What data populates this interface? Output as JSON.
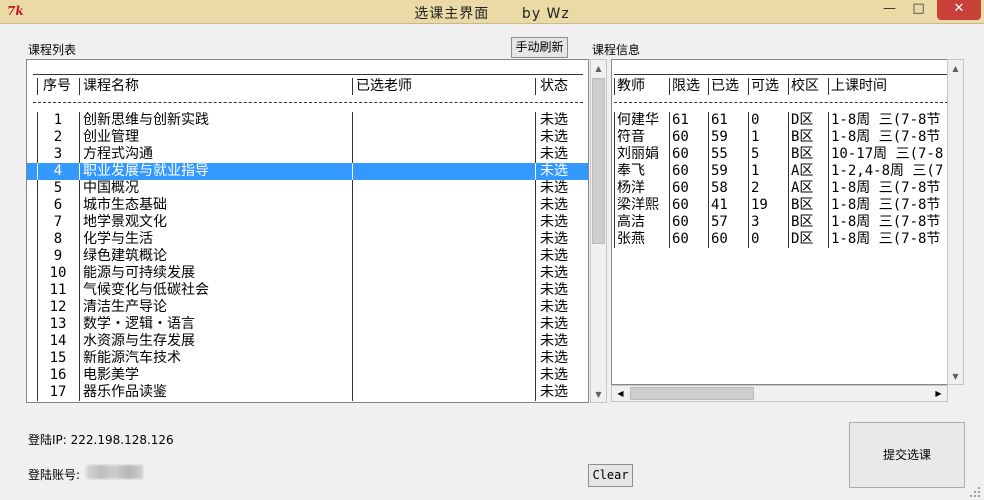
{
  "window": {
    "title": "选课主界面      by Wz",
    "icon_text": "7k",
    "controls": {
      "minimize": "—",
      "maximize": "□",
      "close": "✕"
    }
  },
  "left": {
    "label": "课程列表",
    "refresh_button": "手动刷新",
    "headers": {
      "seq": "序号",
      "name": "课程名称",
      "teacher": "已选老师",
      "status": "状态"
    },
    "rows": [
      {
        "seq": "1",
        "name": "创新思维与创新实践",
        "teacher": "",
        "status": "未选"
      },
      {
        "seq": "2",
        "name": "创业管理",
        "teacher": "",
        "status": "未选"
      },
      {
        "seq": "3",
        "name": "方程式沟通",
        "teacher": "",
        "status": "未选"
      },
      {
        "seq": "4",
        "name": "职业发展与就业指导",
        "teacher": "",
        "status": "未选"
      },
      {
        "seq": "5",
        "name": "中国概况",
        "teacher": "",
        "status": "未选"
      },
      {
        "seq": "6",
        "name": "城市生态基础",
        "teacher": "",
        "status": "未选"
      },
      {
        "seq": "7",
        "name": "地学景观文化",
        "teacher": "",
        "status": "未选"
      },
      {
        "seq": "8",
        "name": "化学与生活",
        "teacher": "",
        "status": "未选"
      },
      {
        "seq": "9",
        "name": "绿色建筑概论",
        "teacher": "",
        "status": "未选"
      },
      {
        "seq": "10",
        "name": "能源与可持续发展",
        "teacher": "",
        "status": "未选"
      },
      {
        "seq": "11",
        "name": "气候变化与低碳社会",
        "teacher": "",
        "status": "未选"
      },
      {
        "seq": "12",
        "name": "清洁生产导论",
        "teacher": "",
        "status": "未选"
      },
      {
        "seq": "13",
        "name": "数学・逻辑・语言",
        "teacher": "",
        "status": "未选"
      },
      {
        "seq": "14",
        "name": "水资源与生存发展",
        "teacher": "",
        "status": "未选"
      },
      {
        "seq": "15",
        "name": "新能源汽车技术",
        "teacher": "",
        "status": "未选"
      },
      {
        "seq": "16",
        "name": "电影美学",
        "teacher": "",
        "status": "未选"
      },
      {
        "seq": "17",
        "name": "器乐作品读鉴",
        "teacher": "",
        "status": "未选"
      }
    ],
    "selected_row": 4
  },
  "right": {
    "label": "课程信息",
    "headers": {
      "teacher": "教师",
      "limit": "限选",
      "chosen": "已选",
      "available": "可选",
      "campus": "校区",
      "time": "上课时间"
    },
    "rows": [
      {
        "teacher": "何建华",
        "limit": "61",
        "chosen": "61",
        "available": "0",
        "campus": "D区",
        "time": "1-8周 三(7-8节"
      },
      {
        "teacher": "符音",
        "limit": "60",
        "chosen": "59",
        "available": "1",
        "campus": "B区",
        "time": "1-8周 三(7-8节"
      },
      {
        "teacher": "刘丽娟",
        "limit": "60",
        "chosen": "55",
        "available": "5",
        "campus": "B区",
        "time": "10-17周 三(7-8"
      },
      {
        "teacher": "奉飞",
        "limit": "60",
        "chosen": "59",
        "available": "1",
        "campus": "A区",
        "time": "1-2,4-8周 三(7"
      },
      {
        "teacher": "杨洋",
        "limit": "60",
        "chosen": "58",
        "available": "2",
        "campus": "A区",
        "time": "1-8周 三(7-8节"
      },
      {
        "teacher": "梁洋熙",
        "limit": "60",
        "chosen": "41",
        "available": "19",
        "campus": "B区",
        "time": "1-8周 三(7-8节"
      },
      {
        "teacher": "高洁",
        "limit": "60",
        "chosen": "57",
        "available": "3",
        "campus": "B区",
        "time": "1-8周 三(7-8节"
      },
      {
        "teacher": "张燕",
        "limit": "60",
        "chosen": "60",
        "available": "0",
        "campus": "D区",
        "time": "1-8周 三(7-8节"
      }
    ]
  },
  "footer": {
    "ip_label": "登陆IP: 222.198.128.126",
    "account_label": "登陆账号:",
    "clear_button": "Clear",
    "submit_button": "提交选课"
  },
  "colors": {
    "titlebar": "#ebd9a6",
    "selection": "#3399ff",
    "close_button": "#c7413a"
  }
}
